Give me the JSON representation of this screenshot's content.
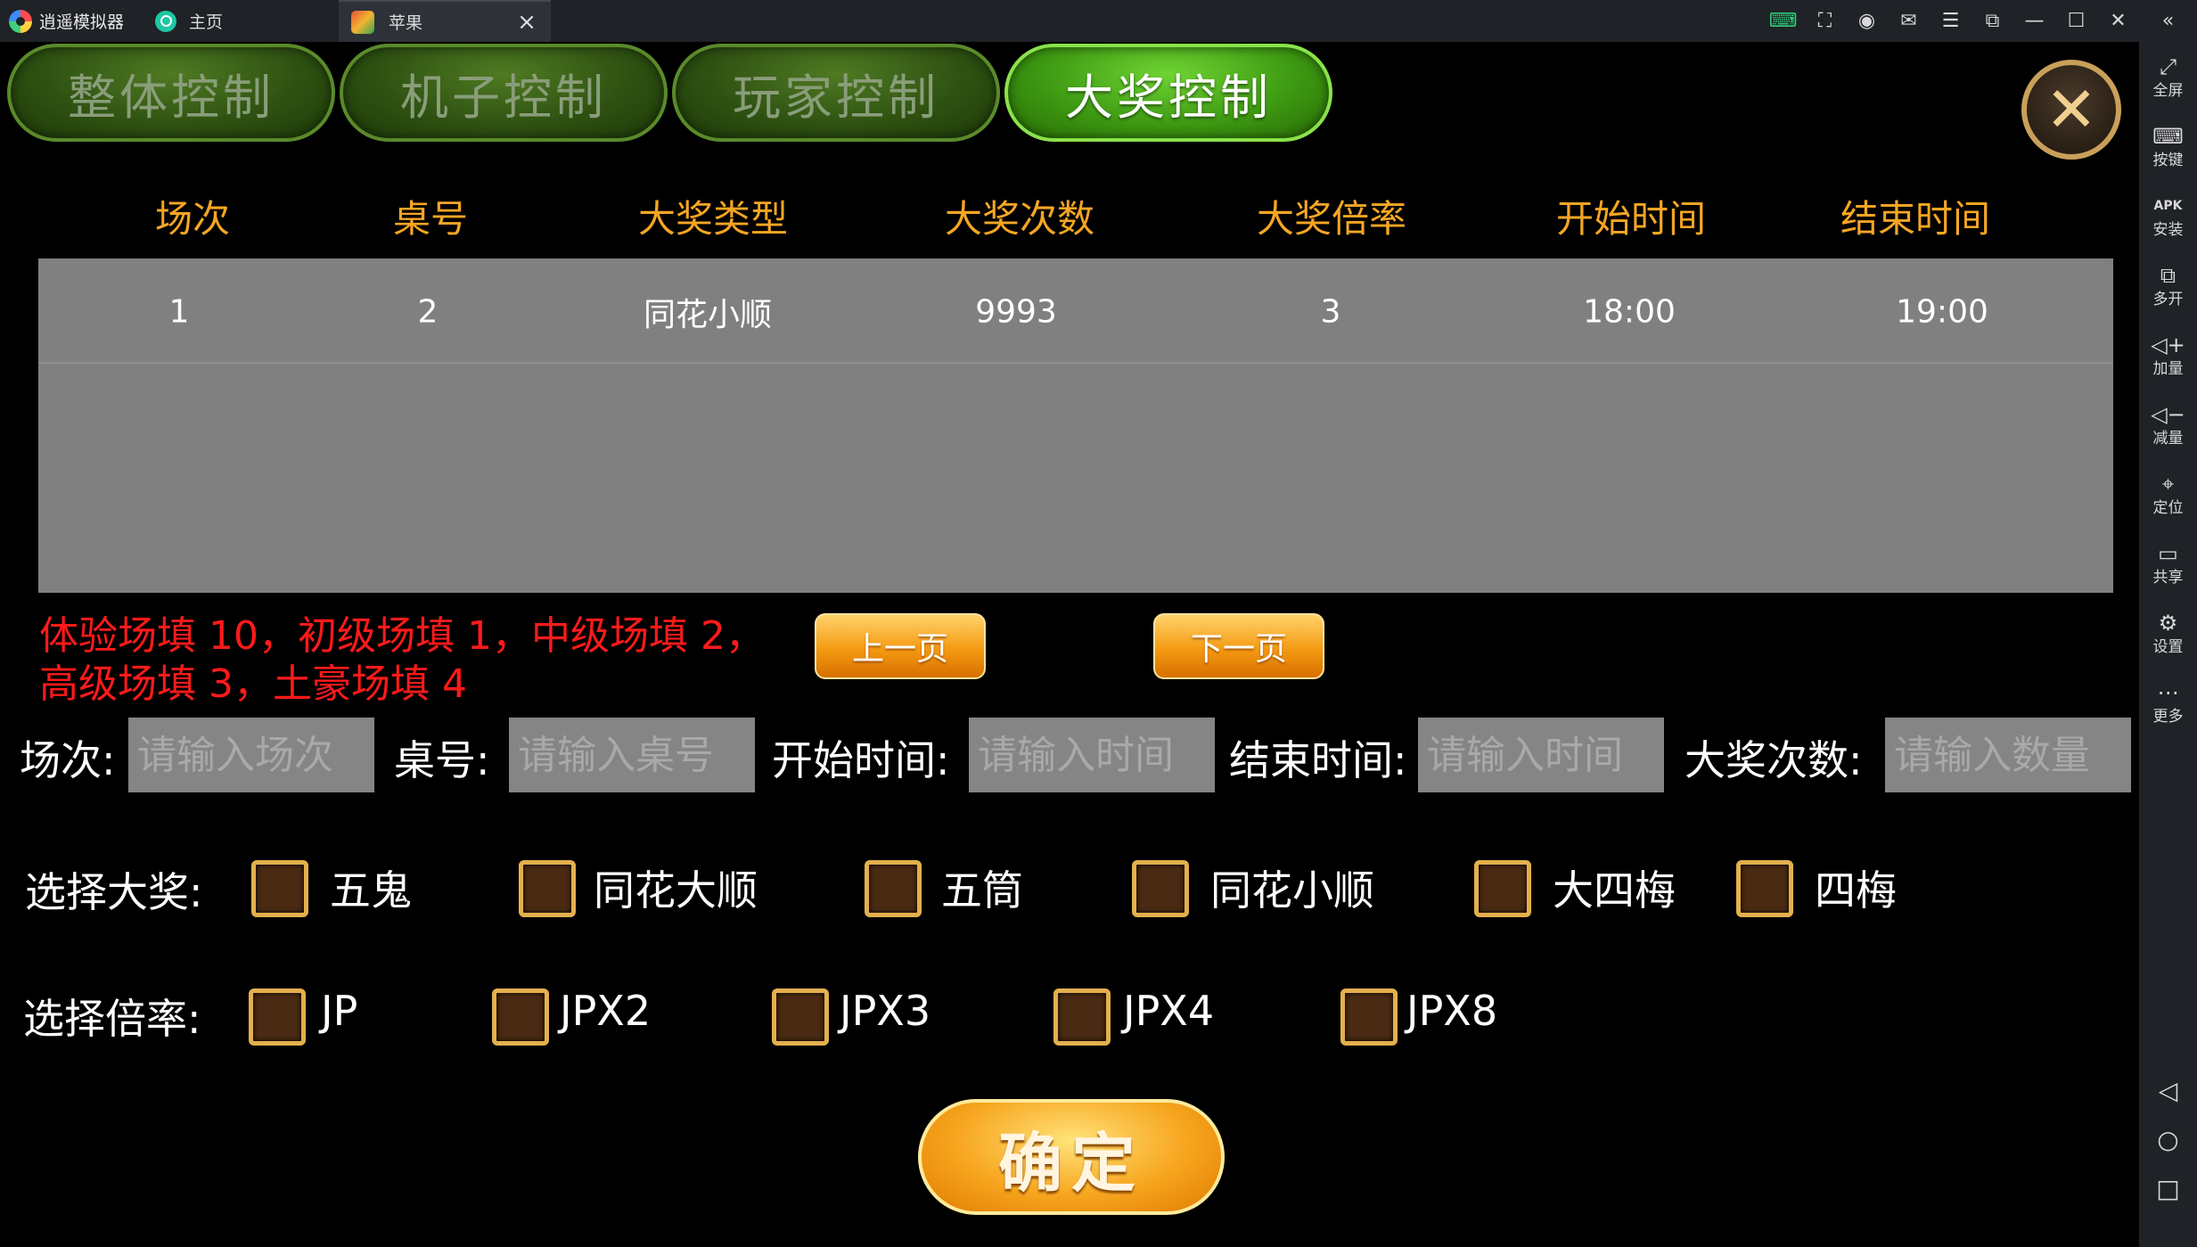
{
  "window": {
    "brand": "逍遥模拟器",
    "tabs": [
      {
        "label": "主页"
      },
      {
        "label": "苹果"
      }
    ],
    "toolbar_icons": [
      "keyboard-map-icon",
      "screenshot-icon",
      "account-icon",
      "mail-icon",
      "menu-icon",
      "restore-icon",
      "minimize-icon",
      "maximize-icon",
      "close-icon",
      "collapse-icon"
    ]
  },
  "sidebar": {
    "items": [
      {
        "label": "全屏",
        "icon": "fullscreen-icon"
      },
      {
        "label": "按键",
        "icon": "keyboard-icon"
      },
      {
        "label": "安装",
        "icon": "apk-install-icon"
      },
      {
        "label": "多开",
        "icon": "multi-instance-icon"
      },
      {
        "label": "加量",
        "icon": "volume-up-icon"
      },
      {
        "label": "减量",
        "icon": "volume-down-icon"
      },
      {
        "label": "定位",
        "icon": "location-icon"
      },
      {
        "label": "共享",
        "icon": "folder-icon"
      },
      {
        "label": "设置",
        "icon": "settings-icon"
      },
      {
        "label": "更多",
        "icon": "more-icon"
      }
    ],
    "nav": [
      "back-icon",
      "home-icon",
      "recents-icon"
    ]
  },
  "game": {
    "tabs": [
      {
        "label": "整体控制",
        "active": false
      },
      {
        "label": "机子控制",
        "active": false
      },
      {
        "label": "玩家控制",
        "active": false
      },
      {
        "label": "大奖控制",
        "active": true
      }
    ],
    "table": {
      "columns": [
        "场次",
        "桌号",
        "大奖类型",
        "大奖次数",
        "大奖倍率",
        "开始时间",
        "结束时间"
      ],
      "rows": [
        [
          "1",
          "2",
          "同花小顺",
          "9993",
          "3",
          "18:00",
          "19:00"
        ]
      ]
    },
    "hint": {
      "line1": "体验场填 10，初级场填 1，中级场填 2，",
      "line2": "高级场填 3，土豪场填 4"
    },
    "pager": {
      "prev": "上一页",
      "next": "下一页"
    },
    "form": {
      "fields": [
        {
          "label": "场次:",
          "placeholder": "请输入场次",
          "value": ""
        },
        {
          "label": "桌号:",
          "placeholder": "请输入桌号",
          "value": ""
        },
        {
          "label": "开始时间:",
          "placeholder": "请输入时间",
          "value": ""
        },
        {
          "label": "结束时间:",
          "placeholder": "请输入时间",
          "value": ""
        },
        {
          "label": "大奖次数:",
          "placeholder": "请输入数量",
          "value": ""
        }
      ]
    },
    "prize": {
      "label": "选择大奖:",
      "options": [
        {
          "label": "五鬼",
          "checked": false
        },
        {
          "label": "同花大顺",
          "checked": false
        },
        {
          "label": "五筒",
          "checked": false
        },
        {
          "label": "同花小顺",
          "checked": false
        },
        {
          "label": "大四梅",
          "checked": false
        },
        {
          "label": "四梅",
          "checked": false
        }
      ]
    },
    "multiplier": {
      "label": "选择倍率:",
      "options": [
        {
          "label": "JP",
          "checked": false
        },
        {
          "label": "JPX2",
          "checked": false
        },
        {
          "label": "JPX3",
          "checked": false
        },
        {
          "label": "JPX4",
          "checked": false
        },
        {
          "label": "JPX8",
          "checked": false
        }
      ]
    },
    "confirm": "确定"
  },
  "colors": {
    "header_text": "#f5a623",
    "hint_text": "#ff1a1a",
    "table_bg": "#808080",
    "checkbox_border": "#e4b04d",
    "active_tab": "#3e9a12"
  }
}
